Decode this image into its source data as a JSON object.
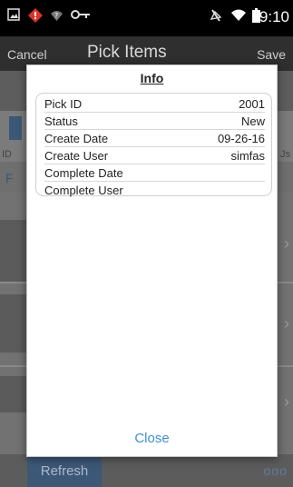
{
  "status_bar": {
    "time": "9:10",
    "icons": [
      "image-icon",
      "alert-icon",
      "wifi-question-icon",
      "key-icon",
      "mute-icon",
      "wifi-icon",
      "battery-icon"
    ]
  },
  "header": {
    "cancel_label": "Cancel",
    "title": "Pick Items",
    "save_label": "Save"
  },
  "background": {
    "col_left_label": "ID",
    "col_right_label": "Js",
    "row_label": "F"
  },
  "bottom_bar": {
    "refresh_label": "Refresh",
    "more_label": "ooo"
  },
  "dialog": {
    "title": "Info",
    "rows": [
      {
        "label": "Pick ID",
        "value": "2001"
      },
      {
        "label": "Status",
        "value": "New"
      },
      {
        "label": "Create Date",
        "value": "09-26-16"
      },
      {
        "label": "Create User",
        "value": "simfas"
      },
      {
        "label": "Complete Date",
        "value": ""
      },
      {
        "label": "Complete User",
        "value": ""
      }
    ],
    "close_label": "Close"
  },
  "colors": {
    "status_bar_bg": "#000000",
    "header_bg": "#2f2f2f",
    "refresh_bg": "#3d5877",
    "close_text": "#3f8fd6"
  }
}
